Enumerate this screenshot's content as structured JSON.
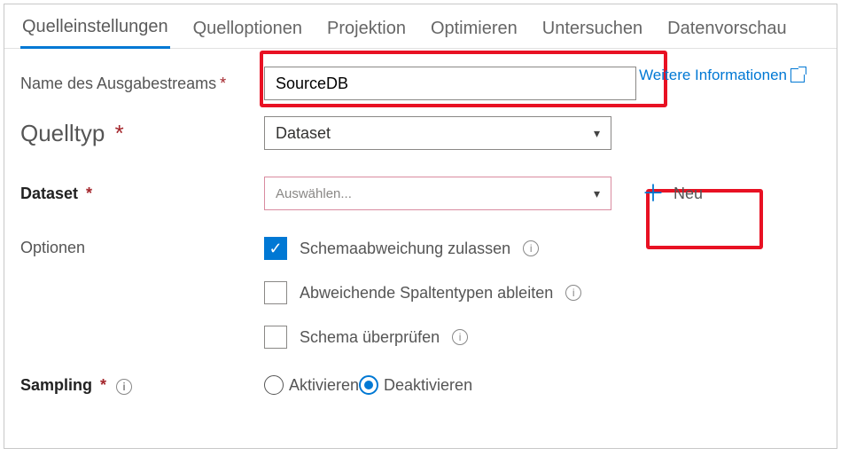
{
  "tabs": {
    "t0": "Quelleinstellungen",
    "t1": "Quelloptionen",
    "t2": "Projektion",
    "t3": "Optimieren",
    "t4": "Untersuchen",
    "t5": "Datenvorschau"
  },
  "labels": {
    "outputStream": "Name des Ausgabestreams",
    "sourceType": "Quelltyp",
    "dataset": "Dataset",
    "options": "Optionen",
    "sampling": "Sampling"
  },
  "fields": {
    "outputStreamValue": "SourceDB",
    "sourceTypeValue": "Dataset",
    "datasetPlaceholder": "Auswählen..."
  },
  "link": {
    "moreInfo": "Weitere Informationen"
  },
  "buttons": {
    "new": "Neu"
  },
  "options": {
    "opt1": "Schemaabweichung zulassen",
    "opt2": "Abweichende Spaltentypen ableiten",
    "opt3": "Schema überprüfen"
  },
  "sampling": {
    "enable": "Aktivieren",
    "disable": "Deaktivieren"
  }
}
